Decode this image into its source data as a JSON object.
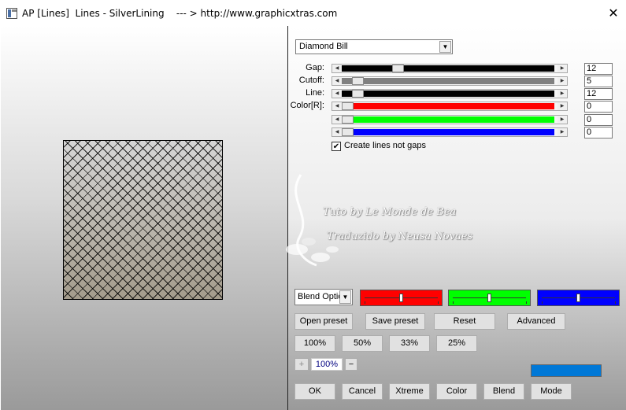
{
  "window": {
    "title": "AP [Lines]  Lines - SilverLining    --- > http://www.graphicxtras.com",
    "close_glyph": "✕"
  },
  "preset": {
    "selected": "Diamond Bill"
  },
  "sliders": [
    {
      "label": "Gap:",
      "value": "12",
      "level": 0.25,
      "fill_color": "#000000"
    },
    {
      "label": "Cutoff:",
      "value": "5",
      "level": 0.05,
      "fill_color": "#808080"
    },
    {
      "label": "Line:",
      "value": "12",
      "level": 0.05,
      "fill_color": "#000000"
    },
    {
      "label": "Color[R]:",
      "value": "0",
      "level": 0.0,
      "fill_color": "#ff0000"
    },
    {
      "label": "",
      "value": "0",
      "level": 0.0,
      "fill_color": "#00ff00"
    },
    {
      "label": "",
      "value": "0",
      "level": 0.0,
      "fill_color": "#0000ff"
    }
  ],
  "checkbox": {
    "label": "Create lines not gaps",
    "checked": true,
    "mark": "✔"
  },
  "watermark": {
    "line1": "Tuto by Le Monde de Bea",
    "line2": "Traduzido by Neusa Novaes"
  },
  "blend": {
    "selected": "Blend Optio"
  },
  "color_swatches": [
    {
      "color": "#ff0000",
      "level": 0.5
    },
    {
      "color": "#00ff00",
      "level": 0.5
    },
    {
      "color": "#0000ff",
      "level": 0.5
    }
  ],
  "buttons_row1": [
    "Open preset",
    "Save preset",
    "Reset",
    "Advanced"
  ],
  "zoom_buttons": [
    "100%",
    "50%",
    "33%",
    "25%"
  ],
  "zoom": {
    "minus": "−",
    "plus": "+",
    "value": "100%"
  },
  "accent_color": "#0078d7",
  "bottom_buttons": [
    "OK",
    "Cancel",
    "Xtreme",
    "Color",
    "Blend",
    "Mode"
  ]
}
